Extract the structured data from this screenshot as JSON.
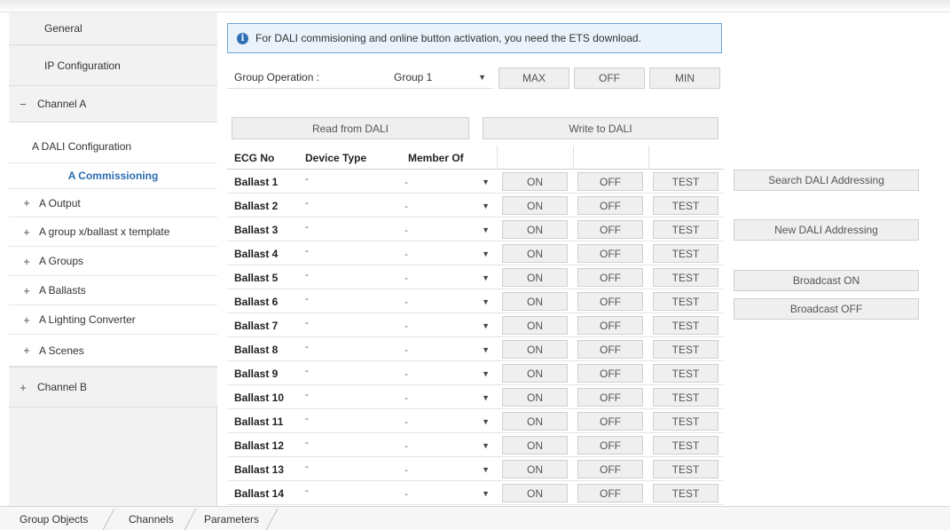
{
  "sidebar": {
    "items": [
      {
        "label": "General",
        "prefix": ""
      },
      {
        "label": "IP Configuration",
        "prefix": ""
      },
      {
        "label": "Channel A",
        "prefix": "−"
      },
      {
        "label": "A DALI Configuration",
        "prefix": ""
      },
      {
        "label": "A Commissioning",
        "prefix": ""
      },
      {
        "label": "A Output",
        "prefix": "+"
      },
      {
        "label": "A group x/ballast x template",
        "prefix": "+"
      },
      {
        "label": "A Groups",
        "prefix": "+"
      },
      {
        "label": "A Ballasts",
        "prefix": "+"
      },
      {
        "label": "A Lighting Converter",
        "prefix": "+"
      },
      {
        "label": "A Scenes",
        "prefix": "+"
      },
      {
        "label": "Channel B",
        "prefix": "+"
      }
    ]
  },
  "info": {
    "text": "For DALI commisioning and online button activation, you need the ETS download."
  },
  "group_operation": {
    "label": "Group Operation :",
    "selected": "Group 1",
    "max_label": "MAX",
    "off_label": "OFF",
    "min_label": "MIN"
  },
  "actions": {
    "read_label": "Read from DALI",
    "write_label": "Write to DALI"
  },
  "table": {
    "headers": [
      "ECG No",
      "Device Type",
      "Member Of"
    ],
    "rows": [
      {
        "ecg": "Ballast 1",
        "device": "-",
        "member": "-",
        "on": "ON",
        "off": "OFF",
        "test": "TEST"
      },
      {
        "ecg": "Ballast 2",
        "device": "-",
        "member": "-",
        "on": "ON",
        "off": "OFF",
        "test": "TEST"
      },
      {
        "ecg": "Ballast 3",
        "device": "-",
        "member": "-",
        "on": "ON",
        "off": "OFF",
        "test": "TEST"
      },
      {
        "ecg": "Ballast 4",
        "device": "-",
        "member": "-",
        "on": "ON",
        "off": "OFF",
        "test": "TEST"
      },
      {
        "ecg": "Ballast 5",
        "device": "-",
        "member": "-",
        "on": "ON",
        "off": "OFF",
        "test": "TEST"
      },
      {
        "ecg": "Ballast 6",
        "device": "-",
        "member": "-",
        "on": "ON",
        "off": "OFF",
        "test": "TEST"
      },
      {
        "ecg": "Ballast 7",
        "device": "-",
        "member": "-",
        "on": "ON",
        "off": "OFF",
        "test": "TEST"
      },
      {
        "ecg": "Ballast 8",
        "device": "-",
        "member": "-",
        "on": "ON",
        "off": "OFF",
        "test": "TEST"
      },
      {
        "ecg": "Ballast 9",
        "device": "-",
        "member": "-",
        "on": "ON",
        "off": "OFF",
        "test": "TEST"
      },
      {
        "ecg": "Ballast 10",
        "device": "-",
        "member": "-",
        "on": "ON",
        "off": "OFF",
        "test": "TEST"
      },
      {
        "ecg": "Ballast 11",
        "device": "-",
        "member": "-",
        "on": "ON",
        "off": "OFF",
        "test": "TEST"
      },
      {
        "ecg": "Ballast 12",
        "device": "-",
        "member": "-",
        "on": "ON",
        "off": "OFF",
        "test": "TEST"
      },
      {
        "ecg": "Ballast 13",
        "device": "-",
        "member": "-",
        "on": "ON",
        "off": "OFF",
        "test": "TEST"
      },
      {
        "ecg": "Ballast 14",
        "device": "-",
        "member": "-",
        "on": "ON",
        "off": "OFF",
        "test": "TEST"
      }
    ]
  },
  "side_actions": {
    "search_label": "Search DALI Addressing",
    "new_label": "New DALI Addressing",
    "broadcast_on_label": "Broadcast ON",
    "broadcast_off_label": "Broadcast OFF"
  },
  "tabs": [
    "Group Objects",
    "Channels",
    "Parameters"
  ],
  "colors": {
    "accent": "#2b6cb0",
    "info_border": "#6fa5d4",
    "info_bg": "#eaf3fb"
  },
  "icons": {
    "info": "info-icon",
    "dropdown": "chevron-down-icon",
    "collapse": "minus-icon",
    "expand": "plus-icon"
  }
}
